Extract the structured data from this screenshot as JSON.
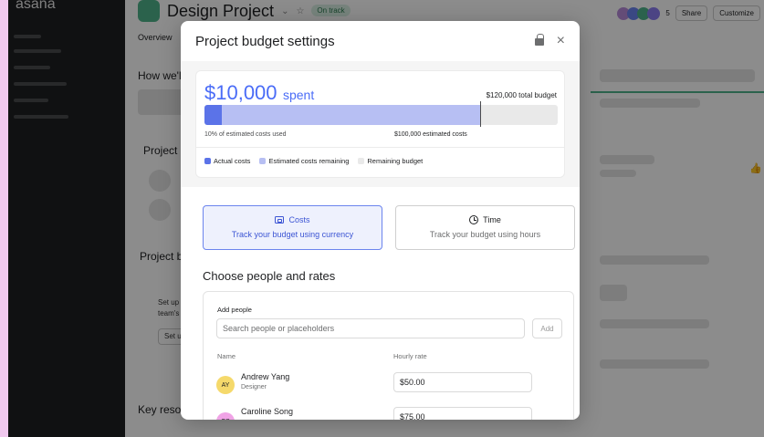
{
  "app": {
    "logo": "asana",
    "project_title": "Design Project",
    "status": "On track",
    "tab_overview": "Overview",
    "share_label": "Share",
    "customize_label": "Customize",
    "members_count": "5"
  },
  "background": {
    "how_heading": "How we'll c",
    "roles_heading": "Project ro",
    "budget_heading": "Project bu",
    "budget_text_1": "Set up yo",
    "budget_text_2": "team's u",
    "setup_btn": "Set up",
    "resources_heading": "Key resour"
  },
  "modal": {
    "title": "Project budget settings",
    "close_symbol": "×"
  },
  "budget": {
    "spent_amount": "$10,000",
    "spent_label": "spent",
    "total_budget": "$120,000 total budget",
    "pct_used_text": "10% of estimated costs used",
    "estimated_costs_text": "$100,000 estimated costs",
    "actual_fraction": 0.05,
    "estimated_fraction": 0.78,
    "legend": {
      "actual": "Actual costs",
      "estimated_remaining": "Estimated costs remaining",
      "remaining_budget": "Remaining budget"
    },
    "colors": {
      "actual": "#5b73e8",
      "estimated": "#b7bff3",
      "remaining": "#e9e9e9"
    }
  },
  "modes": {
    "costs": {
      "title": "Costs",
      "subtitle": "Track your budget using currency",
      "selected": true
    },
    "time": {
      "title": "Time",
      "subtitle": "Track your budget using hours",
      "selected": false
    }
  },
  "people": {
    "section_title": "Choose people and rates",
    "add_people_label": "Add people",
    "search_placeholder": "Search people or placeholders",
    "add_button": "Add",
    "col_name": "Name",
    "col_rate": "Hourly rate",
    "rows": [
      {
        "initials": "AY",
        "name": "Andrew Yang",
        "role": "Designer",
        "rate": "$50.00",
        "avatar_color": "#f5d96b"
      },
      {
        "initials": "CS",
        "name": "Caroline Song",
        "role": "",
        "rate": "$75.00",
        "avatar_color": "#f0a3e6"
      }
    ]
  }
}
